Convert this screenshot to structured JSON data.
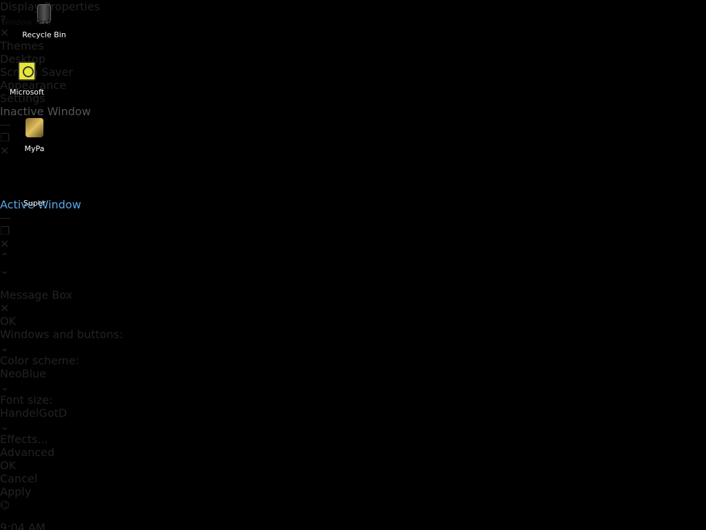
{
  "desktop": {
    "icons": [
      {
        "label": "Recycle Bin",
        "icon": "recycle-bin-icon"
      },
      {
        "label": "Microsoft",
        "icon": "microsoft-app-icon"
      },
      {
        "label": "MyPa",
        "icon": "mypa-app-icon"
      },
      {
        "label": "Super",
        "icon": "super-app-icon"
      }
    ]
  },
  "dialog": {
    "title": "Display Properties",
    "help_label": "?",
    "close_label": "✕",
    "tabs": [
      {
        "label": "Themes"
      },
      {
        "label": "Desktop"
      },
      {
        "label": "Screen Saver"
      },
      {
        "label": "Appearance"
      },
      {
        "label": "Settings"
      }
    ],
    "active_tab": "Appearance",
    "preview": {
      "inactive_title": "Inactive Window",
      "active_title": "Active Window",
      "window_text": "Window Text",
      "message_title": "Message Box",
      "message_ok": "OK",
      "min_glyph": "—",
      "max_glyph": "❐",
      "close_glyph": "✕",
      "scroll_up": "⌃",
      "scroll_down": "⌄"
    },
    "windows_buttons": {
      "label": "Windows and buttons:",
      "value": ""
    },
    "color_scheme": {
      "label": "Color scheme:",
      "value": "NeoBlue"
    },
    "font_size": {
      "label": "Font size:",
      "value": "HandelGotD"
    },
    "effects_label": "Effects...",
    "advanced_label": "Advanced",
    "ok_label": "OK",
    "cancel_label": "Cancel",
    "apply_label": "Apply",
    "dropdown_glyph": "⌄"
  },
  "taskbar": {
    "start_glyph": "⌬",
    "clock": "9:04 AM"
  }
}
